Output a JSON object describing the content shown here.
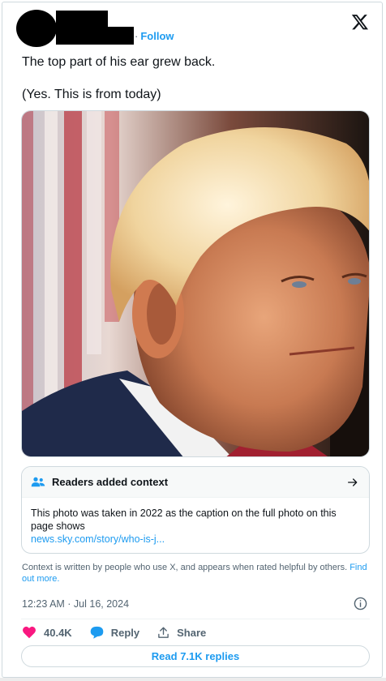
{
  "header": {
    "follow_label": "Follow",
    "separator": "·",
    "logo_icon": "x-logo-icon"
  },
  "tweet": {
    "line1": "The top part of his ear grew back.",
    "line2": "(Yes. This is from today)"
  },
  "media": {
    "icon": "photo-portrait"
  },
  "note": {
    "title": "Readers added context",
    "body": "This photo was taken in 2022 as the caption on the full photo on this page shows",
    "link": "news.sky.com/story/who-is-j...",
    "icons": [
      "people-icon",
      "arrow-right-icon"
    ]
  },
  "context_line": {
    "text": "Context is written by people who use X, and appears when rated helpful by others.",
    "link": "Find out more."
  },
  "meta": {
    "timestamp": "12:23 AM · Jul 16, 2024"
  },
  "actions": {
    "likes": "40.4K",
    "reply_label": "Reply",
    "share_label": "Share"
  },
  "read_replies": "Read 7.1K replies",
  "colors": {
    "accent": "#1d9bf0",
    "like": "#f91880",
    "text": "#0f1419",
    "muted": "#536471",
    "border": "#cfd9de"
  }
}
